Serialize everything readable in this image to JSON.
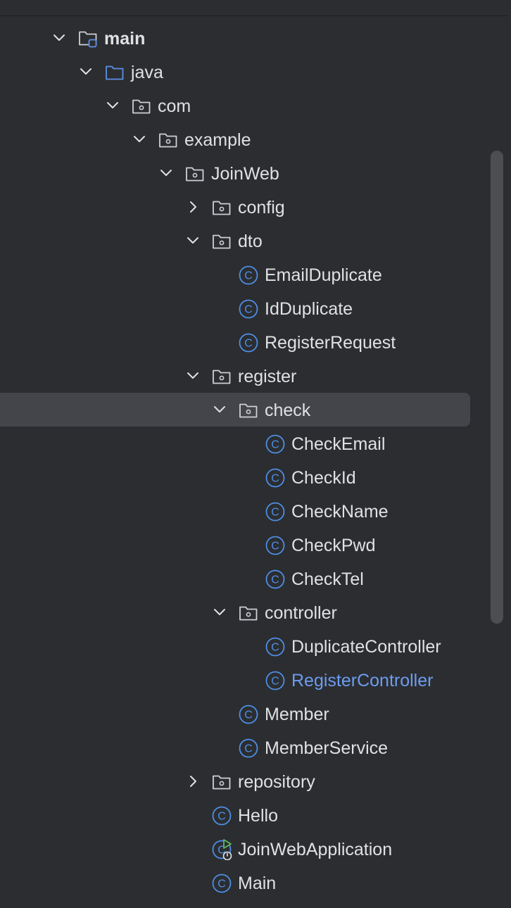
{
  "project_tree": {
    "nodes": [
      {
        "label": "main",
        "type": "source-root",
        "expanded": true,
        "bold": true,
        "depth": 0
      },
      {
        "label": "java",
        "type": "java-source-root",
        "expanded": true,
        "depth": 1
      },
      {
        "label": "com",
        "type": "package",
        "expanded": true,
        "depth": 2
      },
      {
        "label": "example",
        "type": "package",
        "expanded": true,
        "depth": 3
      },
      {
        "label": "JoinWeb",
        "type": "package",
        "expanded": true,
        "depth": 4
      },
      {
        "label": "config",
        "type": "package",
        "expanded": false,
        "depth": 5
      },
      {
        "label": "dto",
        "type": "package",
        "expanded": true,
        "depth": 5
      },
      {
        "label": "EmailDuplicate",
        "type": "class",
        "depth": 6
      },
      {
        "label": "IdDuplicate",
        "type": "class",
        "depth": 6
      },
      {
        "label": "RegisterRequest",
        "type": "class",
        "depth": 6
      },
      {
        "label": "register",
        "type": "package",
        "expanded": true,
        "depth": 5
      },
      {
        "label": "check",
        "type": "package",
        "expanded": true,
        "selected": true,
        "depth": 6
      },
      {
        "label": "CheckEmail",
        "type": "class",
        "depth": 7
      },
      {
        "label": "CheckId",
        "type": "class",
        "depth": 7
      },
      {
        "label": "CheckName",
        "type": "class",
        "depth": 7
      },
      {
        "label": "CheckPwd",
        "type": "class",
        "depth": 7
      },
      {
        "label": "CheckTel",
        "type": "class",
        "depth": 7
      },
      {
        "label": "controller",
        "type": "package",
        "expanded": true,
        "depth": 6
      },
      {
        "label": "DuplicateController",
        "type": "class",
        "depth": 7
      },
      {
        "label": "RegisterController",
        "type": "class",
        "modified": true,
        "depth": 7
      },
      {
        "label": "Member",
        "type": "class",
        "depth": 6
      },
      {
        "label": "MemberService",
        "type": "class",
        "depth": 6
      },
      {
        "label": "repository",
        "type": "package",
        "expanded": false,
        "depth": 5
      },
      {
        "label": "Hello",
        "type": "class",
        "depth": 5
      },
      {
        "label": "JoinWebApplication",
        "type": "spring-boot-app",
        "depth": 5
      },
      {
        "label": "Main",
        "type": "class",
        "depth": 5
      }
    ]
  },
  "icons": {
    "source-root": "source-root-folder-icon",
    "java-source-root": "java-source-folder-icon",
    "package": "package-folder-icon",
    "class": "java-class-icon",
    "spring-boot-app": "spring-boot-run-class-icon",
    "expanded": "chevron-down-icon",
    "collapsed": "chevron-right-icon"
  },
  "colors": {
    "background": "#2b2d30",
    "text": "#dfe1e5",
    "selected_row": "#43454a",
    "class_icon": "#4f8ee6",
    "folder_icon": "#ced0d6",
    "source_folder_icon": "#5e8fe8",
    "modified_text": "#6d9cf0",
    "run_arrow": "#5fb865"
  }
}
